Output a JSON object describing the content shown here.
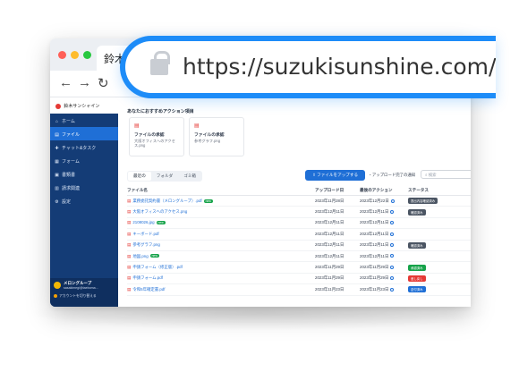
{
  "browser": {
    "tab_title": "鈴木",
    "url": "https://suzukisunshine.com/app/"
  },
  "brand": {
    "name": "鈴木サンシャイン"
  },
  "sidebar": {
    "items": [
      {
        "icon": "home-icon",
        "glyph": "⌂",
        "label": "ホーム",
        "active": false
      },
      {
        "icon": "file-icon",
        "glyph": "▤",
        "label": "ファイル",
        "active": true
      },
      {
        "icon": "chat-icon",
        "glyph": "✚",
        "label": "チャット&タスク",
        "active": false
      },
      {
        "icon": "form-icon",
        "glyph": "▦",
        "label": "フォーム",
        "active": false
      },
      {
        "icon": "document-icon",
        "glyph": "▣",
        "label": "書類書",
        "active": false
      },
      {
        "icon": "invoice-icon",
        "glyph": "▥",
        "label": "請求関連",
        "active": false
      },
      {
        "icon": "gear-icon",
        "glyph": "⚙",
        "label": "設定",
        "active": false
      }
    ],
    "user": {
      "name": "メロングループ",
      "email": "sasakimegi@taeboma...",
      "switch_label": "アカウントを切り替える"
    }
  },
  "main": {
    "recent_heading": "あなたにおすすめアクション項目",
    "cards": [
      {
        "title": "ファイルの承認",
        "subtitle": "大阪オフィスへのアクセス.png"
      },
      {
        "title": "ファイルの承認",
        "subtitle": "参考グラフ.png"
      }
    ],
    "tabs": [
      "最近の",
      "フォルダ",
      "ゴミ箱"
    ],
    "upload_label": "ファイルをアップする",
    "notify_label": "アップロード完了の通知",
    "search_placeholder": "検索",
    "table": {
      "headers": [
        "ファイル名",
        "アップロード日",
        "最後のアクション",
        "ステータス"
      ],
      "rows": [
        {
          "name": "業務委託契約書（メロングループ）.pdf",
          "new": true,
          "uploaded": "2023年11月28日",
          "action": "2023年12月22日",
          "status": "提出内容確認済み",
          "status_color": "#4b5563"
        },
        {
          "name": "大阪オフィスへのアクセス.png",
          "new": false,
          "uploaded": "2023年12月11日",
          "action": "2023年12月11日",
          "status": "確認済み",
          "status_color": "#4b5563"
        },
        {
          "name": "2108026.jpg",
          "new": true,
          "uploaded": "2023年12月11日",
          "action": "2023年12月11日",
          "status": "",
          "status_color": ""
        },
        {
          "name": "キーボード.pdf",
          "new": false,
          "uploaded": "2023年12月11日",
          "action": "2023年12月11日",
          "status": "",
          "status_color": ""
        },
        {
          "name": "参考グラフ.png",
          "new": false,
          "uploaded": "2023年12月11日",
          "action": "2023年12月11日",
          "status": "確認済み",
          "status_color": "#4b5563"
        },
        {
          "name": "地図.png",
          "new": true,
          "uploaded": "2023年12月11日",
          "action": "2023年12月11日",
          "status": "",
          "status_color": ""
        },
        {
          "name": "申請フォーム（修正版）.pdf",
          "new": false,
          "uploaded": "2023年11月29日",
          "action": "2023年11月29日",
          "status": "承認済み",
          "status_color": "#16a34a"
        },
        {
          "name": "申請フォーム.pdf",
          "new": false,
          "uploaded": "2023年11月29日",
          "action": "2023年11月29日",
          "status": "差し戻し",
          "status_color": "#e53935"
        },
        {
          "name": "令和5年確定書.pdf",
          "new": false,
          "uploaded": "2023年11月23日",
          "action": "2023年11月23日",
          "status": "送付済み",
          "status_color": "#1f6fd6"
        }
      ]
    }
  }
}
